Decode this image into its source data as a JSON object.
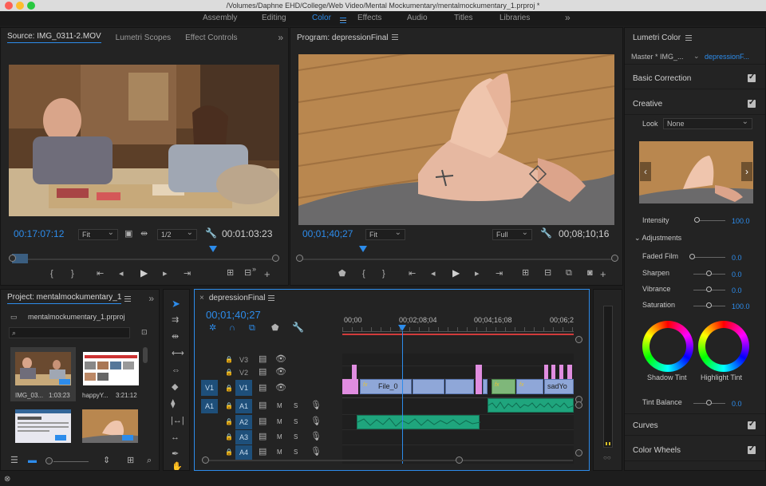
{
  "titlebar": {
    "path": "/Volumes/Daphne EHD/College/Web Video/Mental Mockumentary/mentalmockumentary_1.prproj *"
  },
  "workspaces": {
    "tabs": [
      "Assembly",
      "Editing",
      "Color",
      "Effects",
      "Audio",
      "Titles",
      "Libraries"
    ],
    "active": "Color",
    "more": "»"
  },
  "source": {
    "tabs": [
      "Source: IMG_0311-2.MOV",
      "Lumetri Scopes",
      "Effect Controls"
    ],
    "timecode": "00:17:07:12",
    "fit": "Fit",
    "resolution": "1/2",
    "duration": "00:01:03:23"
  },
  "program": {
    "title": "Program: depressionFinal",
    "timecode": "00;01;40;27",
    "fit": "Fit",
    "quality": "Full",
    "duration": "00;08;10;16"
  },
  "project": {
    "title": "Project: mentalmockumentary_1",
    "file": "mentalmockumentary_1.prproj",
    "items": [
      {
        "name": "IMG_03...",
        "duration": "1:03:23"
      },
      {
        "name": "happyY...",
        "duration": "3:21:12"
      }
    ]
  },
  "timeline": {
    "title": "depressionFinal",
    "timecode": "00;01;40;27",
    "ruler": [
      "00;00",
      "00;02;08;04",
      "00;04;16;08",
      "00;06;2"
    ],
    "tracks": [
      {
        "src": "",
        "id": "V3",
        "type": "video"
      },
      {
        "src": "",
        "id": "V2",
        "type": "video"
      },
      {
        "src": "V1",
        "id": "V1",
        "type": "video"
      },
      {
        "src": "A1",
        "id": "A1",
        "type": "audio"
      },
      {
        "src": "",
        "id": "A2",
        "type": "audio"
      },
      {
        "src": "",
        "id": "A3",
        "type": "audio"
      },
      {
        "src": "",
        "id": "A4",
        "type": "audio"
      }
    ],
    "mute": "M",
    "solo": "S",
    "clips": {
      "file": "File_0",
      "sad": "sadYo",
      "fx": "fx"
    }
  },
  "lumetri": {
    "title": "Lumetri Color",
    "master": "Master * IMG_...",
    "seq": "depressionF...",
    "basic": "Basic Correction",
    "creative": "Creative",
    "look_label": "Look",
    "look_value": "None",
    "intensity_label": "Intensity",
    "intensity": "100.0",
    "adjustments": "Adjustments",
    "faded_label": "Faded Film",
    "faded": "0.0",
    "sharpen_label": "Sharpen",
    "sharpen": "0.0",
    "vibrance_label": "Vibrance",
    "vibrance": "0.0",
    "saturation_label": "Saturation",
    "saturation": "100.0",
    "shadow_tint": "Shadow Tint",
    "highlight_tint": "Highlight Tint",
    "tint_balance_label": "Tint Balance",
    "tint_balance": "0.0",
    "curves": "Curves",
    "wheels": "Color Wheels"
  },
  "colors": {
    "accent": "#2d8ceb",
    "audio_clip": "#1fa57d",
    "video_clip": "#8fa7d8",
    "pink_clip": "#e08de0"
  }
}
